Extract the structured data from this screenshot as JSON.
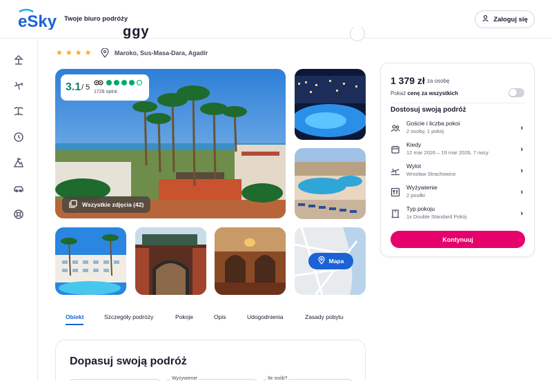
{
  "header": {
    "logo_text": "eSky",
    "tagline": "Twoje biuro podróży",
    "login_label": "Zaloguj się"
  },
  "sidebar": {
    "icons": [
      "beach-icon",
      "plane-icon",
      "island-icon",
      "clock-icon",
      "mountain-icon",
      "car-icon",
      "lifebuoy-icon"
    ]
  },
  "hotel": {
    "title_fragment": "ggy",
    "stars": 4,
    "star_glyph": "★",
    "location": "Maroko, Sus-Masa-Dara, Agadir"
  },
  "rating": {
    "score": "3.1",
    "max": "/ 5",
    "reviews": "1728 opinii",
    "bubbles": 5,
    "filled_bubbles": 4
  },
  "gallery": {
    "all_photos_label": "Wszystkie zdjęcia (42)",
    "map_label": "Mapa"
  },
  "tabs": [
    "Obiekt",
    "Szczegóły podróży",
    "Pokoje",
    "Opis",
    "Udogodnienia",
    "Zasady pobytu"
  ],
  "customize_section": {
    "title": "Dopasuj swoją podróż",
    "field_labels": [
      "Wyżywienie",
      "Ile osób?"
    ]
  },
  "booking": {
    "price": "1 379 zł",
    "price_per": "za osobę",
    "show_price_prefix": "Pokaż ",
    "show_price_bold": "cenę za wszystkich",
    "customize_title": "Dostosuj swoją podróż",
    "options": [
      {
        "icon": "guests-icon",
        "title": "Goście i liczba pokoi",
        "sub": "2 osoby, 1 pokój"
      },
      {
        "icon": "calendar-icon",
        "title": "Kiedy",
        "sub": "12 mar 2026 – 19 mar 2026, 7 nocy"
      },
      {
        "icon": "departure-icon",
        "title": "Wylot",
        "sub": "Wrocław Strachowice"
      },
      {
        "icon": "meal-icon",
        "title": "Wyżywienie",
        "sub": "2 posiłki"
      },
      {
        "icon": "room-icon",
        "title": "Typ pokoju",
        "sub": "1x Double Standard Pokój"
      }
    ],
    "continue_label": "Kontynuuj",
    "chevron": "›"
  },
  "colors": {
    "brand_blue": "#1a62d6",
    "accent_pink": "#e5006b",
    "star": "#f5a623",
    "rating_green": "#12836b"
  }
}
